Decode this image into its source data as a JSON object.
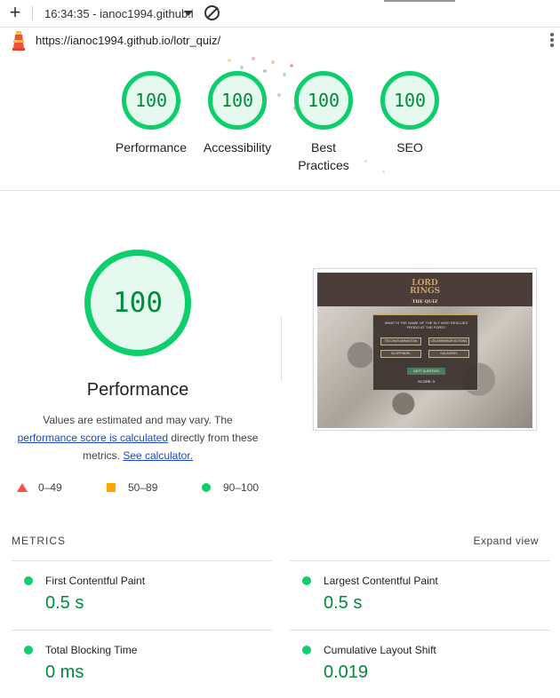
{
  "tabbar": {
    "title": "16:34:35 - ianoc1994.github.i"
  },
  "urlbar": {
    "url": "https://ianoc1994.github.io/lotr_quiz/"
  },
  "gauges": [
    {
      "score": "100",
      "label": "Performance"
    },
    {
      "score": "100",
      "label": "Accessibility"
    },
    {
      "score": "100",
      "label": "Best Practices"
    },
    {
      "score": "100",
      "label": "SEO"
    }
  ],
  "performance": {
    "score": "100",
    "title": "Performance",
    "note_prefix": "Values are estimated and may vary. The",
    "note_link1": "performance score is calculated",
    "note_middle": "directly from these metrics.",
    "note_link2": "See calculator."
  },
  "legend": {
    "fail": "0–49",
    "average": "50–89",
    "pass": "90–100"
  },
  "thumbnail": {
    "logo_line1": "LORD",
    "logo_line2": "RINGS",
    "logo_sub": "THE QUIZ",
    "question": "WHAT IS THE NAME OF THE ELF WHO RESCUES FRODO AT THE FORD?",
    "options": [
      "TELCHAR AMMASTAN",
      "CELEBRIMBOR ELROND",
      "GLORFINDEL",
      "GALADRIEL"
    ],
    "next": "NEXT QUESTION",
    "score": "SCORE: 0"
  },
  "metrics": {
    "header": "METRICS",
    "expand": "Expand view",
    "items": [
      {
        "label": "First Contentful Paint",
        "value": "0.5 s"
      },
      {
        "label": "Largest Contentful Paint",
        "value": "0.5 s"
      },
      {
        "label": "Total Blocking Time",
        "value": "0 ms"
      },
      {
        "label": "Cumulative Layout Shift",
        "value": "0.019"
      }
    ]
  },
  "colors": {
    "pass": "#0cce6b",
    "pass_text": "#008a3b",
    "fail": "#ff4e42",
    "average": "#ffa400",
    "link": "#1a47c9"
  }
}
